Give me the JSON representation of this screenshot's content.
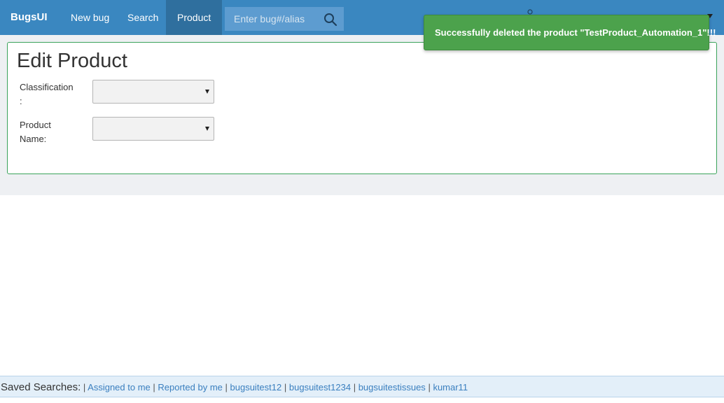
{
  "header": {
    "brand": "BugsUI",
    "nav": [
      {
        "label": "New bug"
      },
      {
        "label": "Search"
      },
      {
        "label": "Product"
      }
    ],
    "search_placeholder": "Enter bug#/alias"
  },
  "toast": {
    "message": "Successfully deleted the product \"TestProduct_Automation_1\"!!!"
  },
  "form": {
    "title": "Edit Product",
    "classification_label": "Classification\n:",
    "classification_value": "",
    "product_name_label": "Product\nName:",
    "product_name_value": ""
  },
  "saved_searches": {
    "title": "Saved Searches:",
    "items": [
      "Assigned to me",
      "Reported by me",
      "bugsuitest12",
      "bugsuitest1234",
      "bugsuitestissues",
      "kumar11"
    ]
  },
  "colors": {
    "header_bg": "#3a87c0",
    "active_nav": "#2f6f9e",
    "toast_bg": "#4ca24c",
    "card_border": "#3aa35a",
    "link": "#3a7fbf"
  },
  "icons": {
    "search": "search-icon",
    "user": "user-icon"
  }
}
